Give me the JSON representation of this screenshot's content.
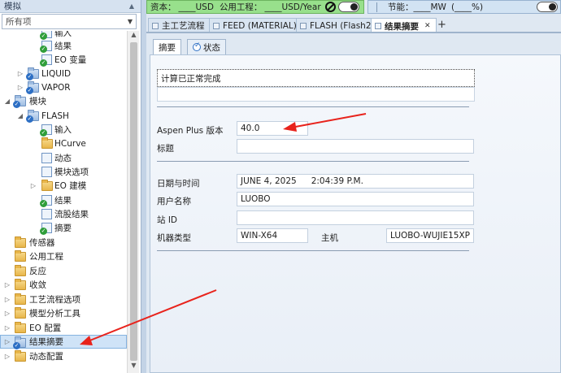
{
  "nav": {
    "header": "模拟",
    "filter_value": "所有项",
    "items": [
      {
        "label": "输入",
        "icon": "form-check-icon"
      },
      {
        "label": "结果",
        "icon": "form-check-icon"
      },
      {
        "label": "EO 变量",
        "icon": "form-check-icon"
      },
      {
        "label": "LIQUID",
        "icon": "stream-folder-icon"
      },
      {
        "label": "VAPOR",
        "icon": "stream-folder-icon"
      },
      {
        "label": "模块",
        "icon": "folder-icon"
      },
      {
        "label": "FLASH",
        "icon": "block-folder-icon"
      },
      {
        "label": "输入",
        "icon": "form-check-icon"
      },
      {
        "label": "HCurve",
        "icon": "folder-icon"
      },
      {
        "label": "动态",
        "icon": "form-icon"
      },
      {
        "label": "模块选项",
        "icon": "form-icon"
      },
      {
        "label": "EO 建模",
        "icon": "folder-icon"
      },
      {
        "label": "结果",
        "icon": "form-check-icon"
      },
      {
        "label": "流股结果",
        "icon": "form-icon"
      },
      {
        "label": "摘要",
        "icon": "form-check-icon"
      },
      {
        "label": "传感器",
        "icon": "folder-icon"
      },
      {
        "label": "公用工程",
        "icon": "folder-icon"
      },
      {
        "label": "反应",
        "icon": "folder-icon"
      },
      {
        "label": "收敛",
        "icon": "folder-icon"
      },
      {
        "label": "工艺流程选项",
        "icon": "folder-icon"
      },
      {
        "label": "模型分析工具",
        "icon": "folder-icon"
      },
      {
        "label": "EO 配置",
        "icon": "folder-icon"
      },
      {
        "label": "结果摘要",
        "icon": "results-folder-icon"
      },
      {
        "label": "动态配置",
        "icon": "folder-icon"
      }
    ]
  },
  "econ": {
    "capital_label": "资本：",
    "capital_value": "____USD",
    "utility_label": "公用工程：",
    "utility_value": "____USD/Year"
  },
  "energy": {
    "label": "节能：",
    "value": "____MW",
    "percent": "(____%)"
  },
  "tabs": [
    {
      "label": "主工艺流程"
    },
    {
      "label": "FEED (MATERIAL)"
    },
    {
      "label": "FLASH (Flash2)"
    },
    {
      "label": "结果摘要",
      "close": "✕"
    }
  ],
  "tab_add": "+",
  "subtabs": {
    "summary": "摘要",
    "status": "状态"
  },
  "form": {
    "status_message": "计算已正常完成",
    "version_label": "Aspen Plus 版本",
    "version_value": "40.0",
    "title_label": "标题",
    "title_value": "",
    "datetime_label": "日期与时间",
    "date_value": "JUNE 4, 2025",
    "time_value": "2:04:39 P.M.",
    "user_label": "用户名称",
    "user_value": "LUOBO",
    "site_label": "站 ID",
    "site_value": "",
    "machine_label": "机器类型",
    "machine_value": "WIN-X64",
    "host_label": "主机",
    "host_value": "LUOBO-WUJIE15XP"
  },
  "colors": {
    "arrow": "#e8231c",
    "econ_bar": "#98e08c",
    "selected": "#cfe3f7"
  }
}
